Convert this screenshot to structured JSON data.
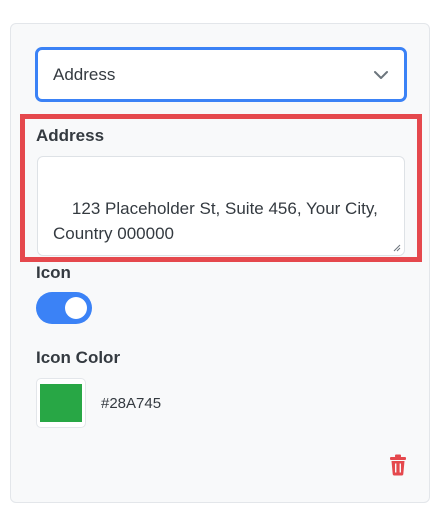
{
  "select": {
    "value": "Address",
    "icon": "chevron-down-icon"
  },
  "address": {
    "label": "Address",
    "value": "123 Placeholder St, Suite 456, Your City,\nCountry 000000"
  },
  "icon_toggle": {
    "label": "Icon",
    "enabled": true,
    "accent_color": "#3B82F6"
  },
  "icon_color": {
    "label": "Icon Color",
    "value": "#28A745"
  },
  "delete": {
    "icon": "trash-icon",
    "color": "#E5484D"
  },
  "highlight_color": "#E5484D"
}
